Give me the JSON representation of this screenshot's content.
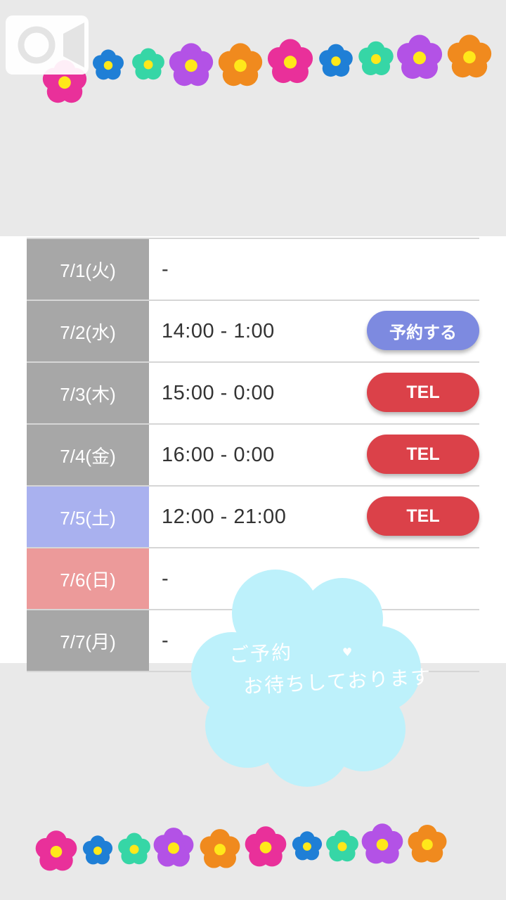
{
  "schedule": [
    {
      "date": "7/1(火)",
      "day_type": "weekday",
      "time": "-",
      "button": ""
    },
    {
      "date": "7/2(水)",
      "day_type": "weekday",
      "time": "14:00 - 1:00",
      "button": "予約する"
    },
    {
      "date": "7/3(木)",
      "day_type": "weekday",
      "time": "15:00 - 0:00",
      "button": "TEL"
    },
    {
      "date": "7/4(金)",
      "day_type": "weekday",
      "time": "16:00 - 0:00",
      "button": "TEL"
    },
    {
      "date": "7/5(土)",
      "day_type": "saturday",
      "time": "12:00 - 21:00",
      "button": "TEL"
    },
    {
      "date": "7/6(日)",
      "day_type": "sunday",
      "time": "-",
      "button": ""
    },
    {
      "date": "7/7(月)",
      "day_type": "weekday",
      "time": "-",
      "button": ""
    }
  ],
  "sticker": {
    "line1": "ご予約",
    "line2": "お待ちしております",
    "heart": "♥"
  },
  "icons": {
    "camera": "video-camera-icon",
    "flower_colors": [
      "#e9309a",
      "#1f7fd6",
      "#36d6a6",
      "#b352e6",
      "#f08a1e",
      "#e9309a",
      "#1f7fd6",
      "#36d6a6",
      "#b352e6",
      "#f08a1e"
    ]
  },
  "colors": {
    "reserve_button": "#7d8ae0",
    "tel_button": "#db4149",
    "weekday_date": "#a7a7a7",
    "saturday_date": "#a9b1ef",
    "sunday_date": "#ec9a9a",
    "sticker_cloud": "#bdf1fb"
  }
}
